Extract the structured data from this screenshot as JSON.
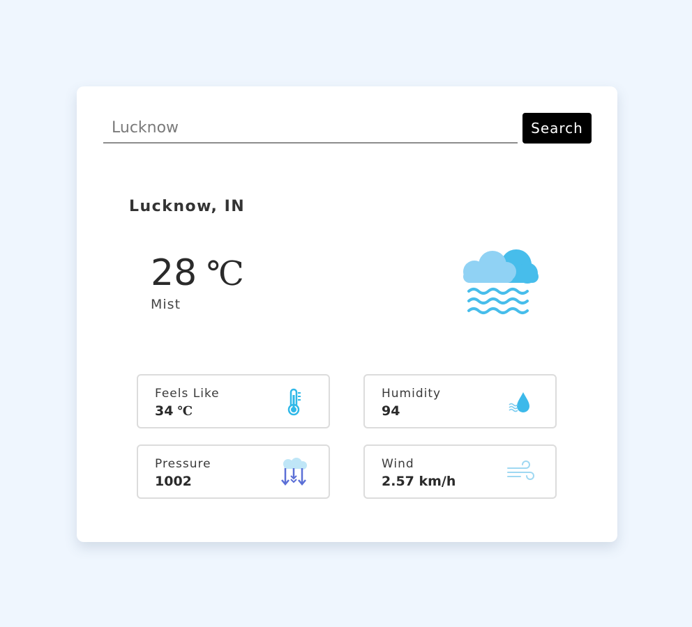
{
  "search": {
    "value": "Lucknow",
    "placeholder": "Lucknow",
    "button_label": "Search"
  },
  "weather": {
    "location": "Lucknow, IN",
    "temperature": "28",
    "temperature_unit": "℃",
    "condition": "Mist",
    "icon": "mist-cloud-icon"
  },
  "stats": {
    "feels_like": {
      "label": "Feels Like",
      "value": "34",
      "unit": "℃",
      "icon": "thermometer-icon"
    },
    "humidity": {
      "label": "Humidity",
      "value": "94",
      "icon": "water-drop-icon"
    },
    "pressure": {
      "label": "Pressure",
      "value": "1002",
      "icon": "pressure-arrows-icon"
    },
    "wind": {
      "label": "Wind",
      "value": "2.57 km/h",
      "icon": "wind-icon"
    }
  },
  "colors": {
    "background": "#eff6fe",
    "card": "#ffffff",
    "button": "#000000",
    "cloud_light": "#90d2f4",
    "cloud_dark": "#47bdeb",
    "pressure_blue": "#5b6fd6"
  }
}
